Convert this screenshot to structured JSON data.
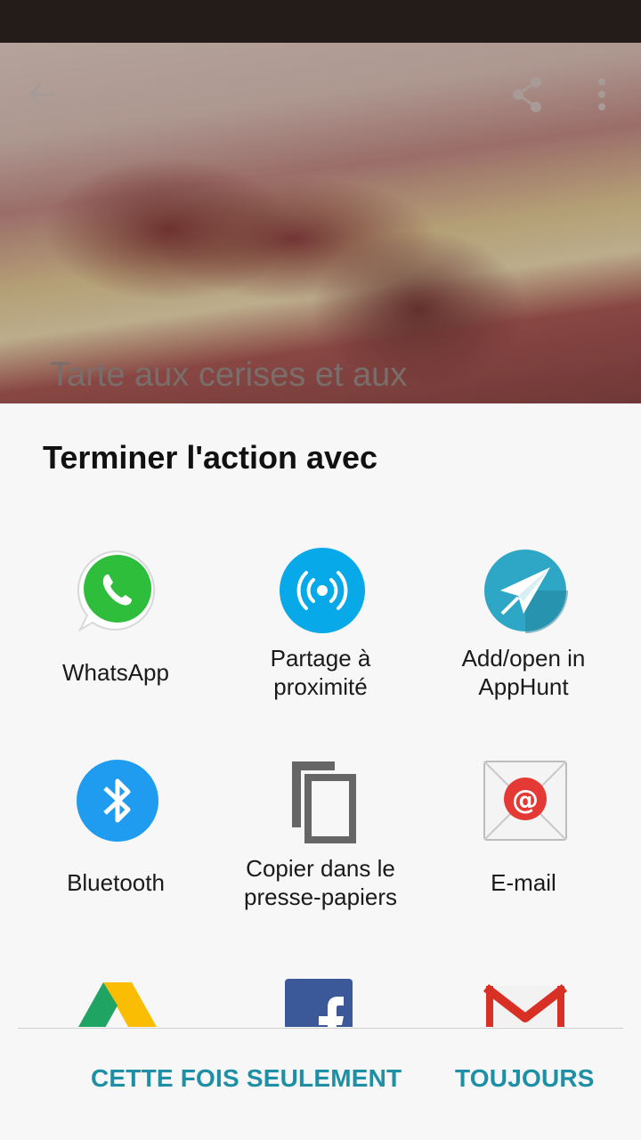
{
  "background_screen": {
    "title": "Tarte aux cerises et aux",
    "back_icon": "arrow-back-icon",
    "share_icon": "share-icon",
    "more_icon": "more-vert-icon"
  },
  "chooser": {
    "title": "Terminer l'action avec",
    "apps": [
      {
        "line1": "WhatsApp",
        "line2": "",
        "icon": "whatsapp-icon",
        "color": "#2fbd3c"
      },
      {
        "line1": "Partage à",
        "line2": "proximité",
        "icon": "nearby-share-icon",
        "color": "#08a9e8"
      },
      {
        "line1": "Add/open in",
        "line2": "AppHunt",
        "icon": "apphunt-icon",
        "color": "#2ea6c5"
      },
      {
        "line1": "Bluetooth",
        "line2": "",
        "icon": "bluetooth-icon",
        "color": "#1f9bef"
      },
      {
        "line1": "Copier dans le",
        "line2": "presse-papiers",
        "icon": "copy-icon",
        "color": "#666666"
      },
      {
        "line1": "E-mail",
        "line2": "",
        "icon": "email-icon",
        "color": "#e53935"
      },
      {
        "line1": "",
        "line2": "",
        "icon": "google-drive-icon",
        "color": "#1fa463"
      },
      {
        "line1": "",
        "line2": "",
        "icon": "facebook-icon",
        "color": "#3b5998"
      },
      {
        "line1": "",
        "line2": "",
        "icon": "gmail-icon",
        "color": "#d93025"
      }
    ],
    "just_once_label": "CETTE FOIS SEULEMENT",
    "always_label": "TOUJOURS",
    "accent_color": "#1e8fa5"
  }
}
